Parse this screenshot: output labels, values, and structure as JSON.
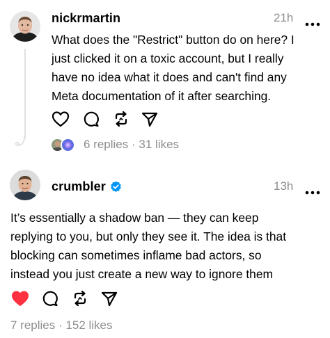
{
  "posts": [
    {
      "username": "nickrmartin",
      "time": "21h",
      "lines": [
        "What does the \"Restrict\" button do on here? I",
        "just clicked it on a toxic account, but I really",
        "have no idea what it does and can't find any",
        "Meta documentation of it after searching."
      ],
      "replies": "6 replies",
      "separator": "·",
      "likes": "31 likes",
      "liked": false
    },
    {
      "username": "crumbler",
      "verified": true,
      "time": "13h",
      "lines": [
        "It’s essentially a shadow ban — they can keep",
        "replying to you, but only they see it. The idea is that",
        "blocking can sometimes inflame bad actors, so",
        "instead you just create a new way to ignore them"
      ],
      "replies": "7 replies",
      "separator": "·",
      "likes": "152 likes",
      "liked": true
    }
  ],
  "colors": {
    "like_active": "#ff3040",
    "verified": "#0095f6",
    "muted_text": "#8e8e8e",
    "thread_line": "#e0e0e0"
  },
  "icons": {
    "more": "more-horizontal-icon",
    "like": "heart-icon",
    "reply": "comment-bubble-icon",
    "repost": "repost-arrows-icon",
    "share": "send-paper-plane-icon"
  }
}
